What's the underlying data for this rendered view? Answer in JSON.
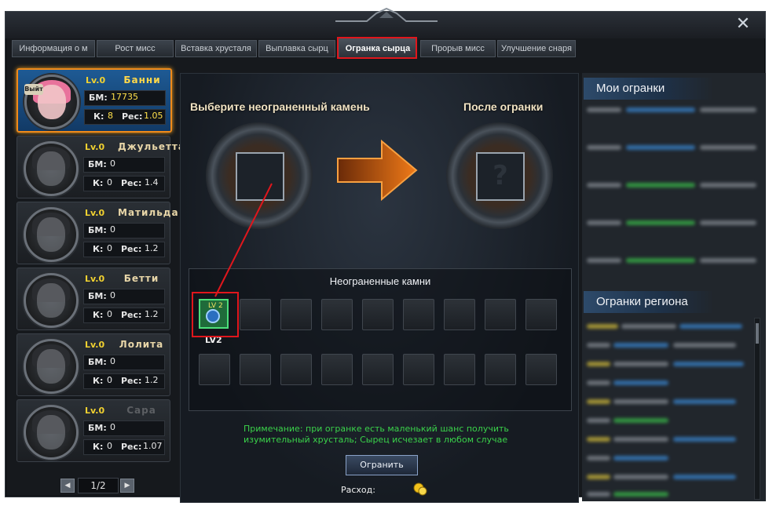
{
  "window": {
    "close_glyph": "✕"
  },
  "tabs": [
    {
      "label": "Информация о м"
    },
    {
      "label": "Рост мисс"
    },
    {
      "label": "Вставка хрусталя"
    },
    {
      "label": "Выплавка сырц"
    },
    {
      "label": "Огранка сырца"
    },
    {
      "label": "Прорыв мисс"
    },
    {
      "label": "Улучшение снаря"
    }
  ],
  "characters": [
    {
      "exit_label": "Выйт",
      "lv": "Lv.0",
      "name": "Банни",
      "bm_label": "БМ:",
      "bm": "17735",
      "k_label": "К:",
      "k": "8",
      "pec_label": "Рес:",
      "pec": "1.05"
    },
    {
      "lv": "Lv.0",
      "name": "Джульетта",
      "bm_label": "БМ:",
      "bm": "0",
      "k_label": "К:",
      "k": "0",
      "pec_label": "Рес:",
      "pec": "1.4"
    },
    {
      "lv": "Lv.0",
      "name": "Матильда",
      "bm_label": "БМ:",
      "bm": "0",
      "k_label": "К:",
      "k": "0",
      "pec_label": "Рес:",
      "pec": "1.2"
    },
    {
      "lv": "Lv.0",
      "name": "Бетти",
      "bm_label": "БМ:",
      "bm": "0",
      "k_label": "К:",
      "k": "0",
      "pec_label": "Рес:",
      "pec": "1.2"
    },
    {
      "lv": "Lv.0",
      "name": "Лолита",
      "bm_label": "БМ:",
      "bm": "0",
      "k_label": "К:",
      "k": "0",
      "pec_label": "Рес:",
      "pec": "1.2"
    },
    {
      "lv": "Lv.0",
      "name": "Сара",
      "bm_label": "БМ:",
      "bm": "0",
      "k_label": "К:",
      "k": "0",
      "pec_label": "Рес:",
      "pec": "1.07"
    }
  ],
  "pager": {
    "page": "1/2",
    "prev": "◀",
    "next": "▶"
  },
  "center": {
    "select_title": "Выберите неограненный камень",
    "after_title": "После огранки",
    "gems_title": "Неограненные камни",
    "gem_lv_small": "LV 2",
    "gem_lv_caption": "LV2",
    "note_line1": "Примечание: при огранке есть маленький шанс получить",
    "note_line2": "изумительный хрусталь; Сырец исчезает в любом случае",
    "cut_button": "Огранить",
    "cost_label": "Расход:",
    "question_glyph": "?"
  },
  "right": {
    "my_cuts": "Мои огранки",
    "region_cuts": "Огранки региона"
  },
  "colors": {
    "highlight": "#e0161c",
    "note_green": "#3ad24a",
    "gold": "#f2d230"
  }
}
